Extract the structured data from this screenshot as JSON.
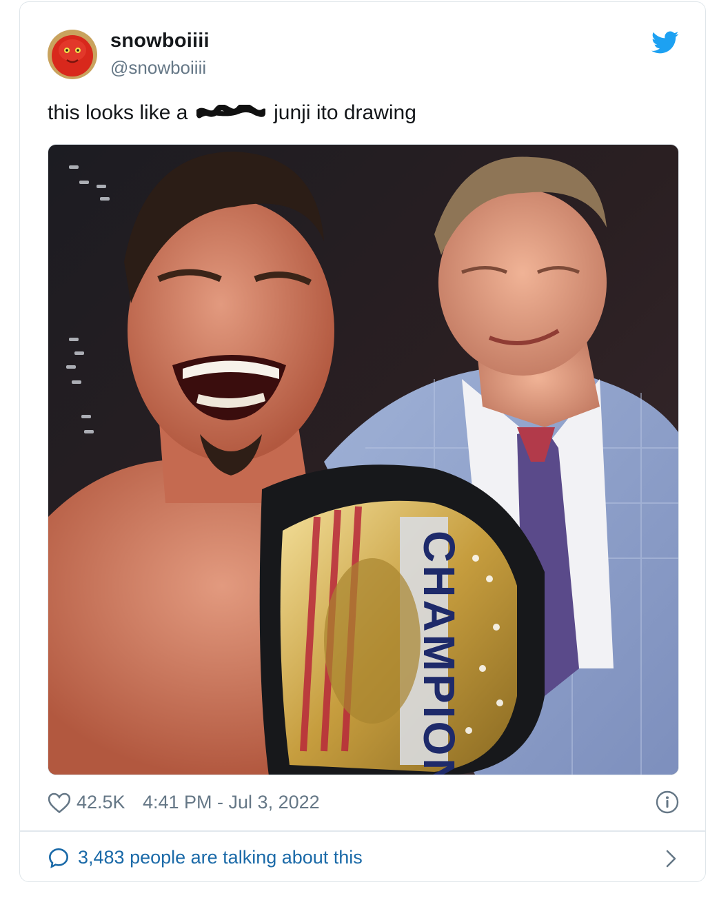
{
  "tweet": {
    "display_name": "snowboiiii",
    "handle": "@snowboiiii",
    "text_before": "this looks like a",
    "text_after": "junji ito drawing",
    "likes": "42.5K",
    "timestamp": "4:41 PM - Jul 3, 2022",
    "conversation": "3,483 people are talking about this"
  },
  "media": {
    "belt_text": "CHAMPION"
  },
  "icons": {
    "brand": "twitter-bird-icon",
    "like": "heart-icon",
    "info": "info-icon",
    "reply": "speech-bubble-icon",
    "go": "chevron-right-icon"
  },
  "colors": {
    "brand_blue": "#1da1f2",
    "link_blue": "#1b6aa8",
    "muted": "#657786",
    "text": "#14171a",
    "border": "#e1e8ed"
  }
}
